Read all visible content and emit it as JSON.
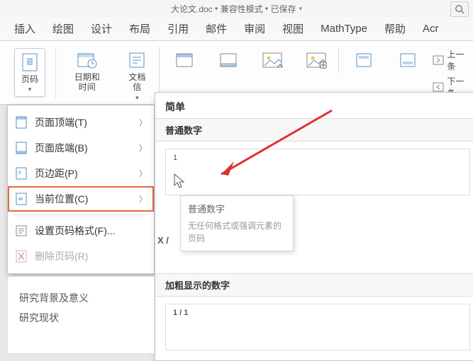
{
  "title_bar": {
    "doc_name": "大论文.doc",
    "mode": "兼容性模式",
    "status": "已保存"
  },
  "ribbon_tabs": [
    "插入",
    "绘图",
    "设计",
    "布局",
    "引用",
    "邮件",
    "审阅",
    "视图",
    "MathType",
    "帮助",
    "Acr"
  ],
  "ribbon": {
    "page_number": "页码",
    "date_time": "日期和时间",
    "doc_info": "文档信",
    "prev": "上一条",
    "next": "下一条"
  },
  "context_menu": {
    "items": [
      {
        "label": "页面顶端(T)",
        "icon": "page-top",
        "sub": true
      },
      {
        "label": "页面底端(B)",
        "icon": "page-bottom",
        "sub": true
      },
      {
        "label": "页边距(P)",
        "icon": "page-margin",
        "sub": true
      },
      {
        "label": "当前位置(C)",
        "icon": "current-pos",
        "sub": true,
        "highlight": true
      },
      {
        "label": "设置页码格式(F)...",
        "icon": "format",
        "sub": false
      },
      {
        "label": "删除页码(R)",
        "icon": "remove",
        "sub": false,
        "disabled": true
      }
    ]
  },
  "gallery": {
    "header": "简单",
    "section1": "普通数字",
    "preview1_num": "1",
    "section2": "加粗显示的数字",
    "preview2_num": "1 / 1"
  },
  "tooltip": {
    "title": "普通数字",
    "desc": "无任何格式或强调元素的页码"
  },
  "xslash": "X /",
  "doc_lines": [
    "研究背景及意义",
    "研究现状"
  ]
}
